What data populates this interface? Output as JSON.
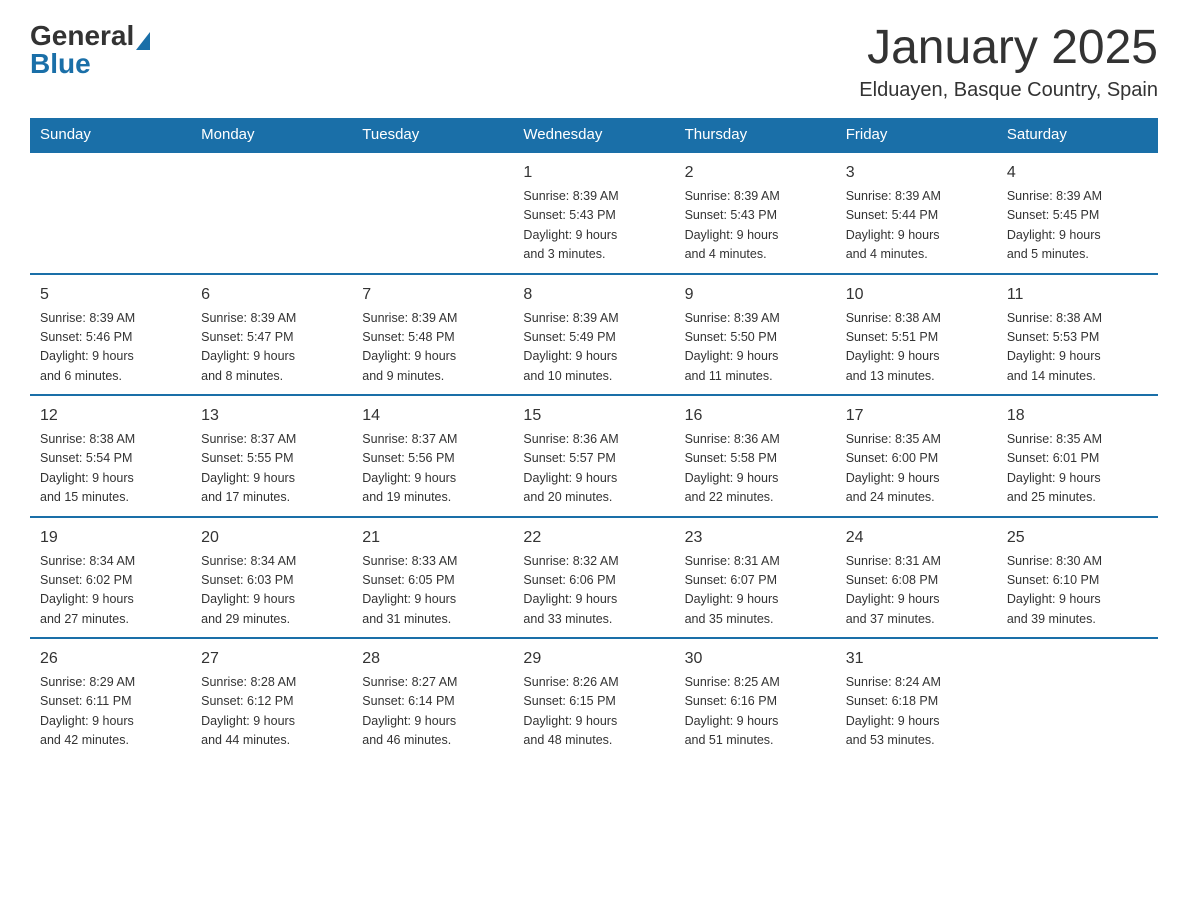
{
  "header": {
    "logo_general": "General",
    "logo_blue": "Blue",
    "month_title": "January 2025",
    "location": "Elduayen, Basque Country, Spain"
  },
  "days_of_week": [
    "Sunday",
    "Monday",
    "Tuesday",
    "Wednesday",
    "Thursday",
    "Friday",
    "Saturday"
  ],
  "weeks": [
    [
      {
        "day": "",
        "info": ""
      },
      {
        "day": "",
        "info": ""
      },
      {
        "day": "",
        "info": ""
      },
      {
        "day": "1",
        "info": "Sunrise: 8:39 AM\nSunset: 5:43 PM\nDaylight: 9 hours\nand 3 minutes."
      },
      {
        "day": "2",
        "info": "Sunrise: 8:39 AM\nSunset: 5:43 PM\nDaylight: 9 hours\nand 4 minutes."
      },
      {
        "day": "3",
        "info": "Sunrise: 8:39 AM\nSunset: 5:44 PM\nDaylight: 9 hours\nand 4 minutes."
      },
      {
        "day": "4",
        "info": "Sunrise: 8:39 AM\nSunset: 5:45 PM\nDaylight: 9 hours\nand 5 minutes."
      }
    ],
    [
      {
        "day": "5",
        "info": "Sunrise: 8:39 AM\nSunset: 5:46 PM\nDaylight: 9 hours\nand 6 minutes."
      },
      {
        "day": "6",
        "info": "Sunrise: 8:39 AM\nSunset: 5:47 PM\nDaylight: 9 hours\nand 8 minutes."
      },
      {
        "day": "7",
        "info": "Sunrise: 8:39 AM\nSunset: 5:48 PM\nDaylight: 9 hours\nand 9 minutes."
      },
      {
        "day": "8",
        "info": "Sunrise: 8:39 AM\nSunset: 5:49 PM\nDaylight: 9 hours\nand 10 minutes."
      },
      {
        "day": "9",
        "info": "Sunrise: 8:39 AM\nSunset: 5:50 PM\nDaylight: 9 hours\nand 11 minutes."
      },
      {
        "day": "10",
        "info": "Sunrise: 8:38 AM\nSunset: 5:51 PM\nDaylight: 9 hours\nand 13 minutes."
      },
      {
        "day": "11",
        "info": "Sunrise: 8:38 AM\nSunset: 5:53 PM\nDaylight: 9 hours\nand 14 minutes."
      }
    ],
    [
      {
        "day": "12",
        "info": "Sunrise: 8:38 AM\nSunset: 5:54 PM\nDaylight: 9 hours\nand 15 minutes."
      },
      {
        "day": "13",
        "info": "Sunrise: 8:37 AM\nSunset: 5:55 PM\nDaylight: 9 hours\nand 17 minutes."
      },
      {
        "day": "14",
        "info": "Sunrise: 8:37 AM\nSunset: 5:56 PM\nDaylight: 9 hours\nand 19 minutes."
      },
      {
        "day": "15",
        "info": "Sunrise: 8:36 AM\nSunset: 5:57 PM\nDaylight: 9 hours\nand 20 minutes."
      },
      {
        "day": "16",
        "info": "Sunrise: 8:36 AM\nSunset: 5:58 PM\nDaylight: 9 hours\nand 22 minutes."
      },
      {
        "day": "17",
        "info": "Sunrise: 8:35 AM\nSunset: 6:00 PM\nDaylight: 9 hours\nand 24 minutes."
      },
      {
        "day": "18",
        "info": "Sunrise: 8:35 AM\nSunset: 6:01 PM\nDaylight: 9 hours\nand 25 minutes."
      }
    ],
    [
      {
        "day": "19",
        "info": "Sunrise: 8:34 AM\nSunset: 6:02 PM\nDaylight: 9 hours\nand 27 minutes."
      },
      {
        "day": "20",
        "info": "Sunrise: 8:34 AM\nSunset: 6:03 PM\nDaylight: 9 hours\nand 29 minutes."
      },
      {
        "day": "21",
        "info": "Sunrise: 8:33 AM\nSunset: 6:05 PM\nDaylight: 9 hours\nand 31 minutes."
      },
      {
        "day": "22",
        "info": "Sunrise: 8:32 AM\nSunset: 6:06 PM\nDaylight: 9 hours\nand 33 minutes."
      },
      {
        "day": "23",
        "info": "Sunrise: 8:31 AM\nSunset: 6:07 PM\nDaylight: 9 hours\nand 35 minutes."
      },
      {
        "day": "24",
        "info": "Sunrise: 8:31 AM\nSunset: 6:08 PM\nDaylight: 9 hours\nand 37 minutes."
      },
      {
        "day": "25",
        "info": "Sunrise: 8:30 AM\nSunset: 6:10 PM\nDaylight: 9 hours\nand 39 minutes."
      }
    ],
    [
      {
        "day": "26",
        "info": "Sunrise: 8:29 AM\nSunset: 6:11 PM\nDaylight: 9 hours\nand 42 minutes."
      },
      {
        "day": "27",
        "info": "Sunrise: 8:28 AM\nSunset: 6:12 PM\nDaylight: 9 hours\nand 44 minutes."
      },
      {
        "day": "28",
        "info": "Sunrise: 8:27 AM\nSunset: 6:14 PM\nDaylight: 9 hours\nand 46 minutes."
      },
      {
        "day": "29",
        "info": "Sunrise: 8:26 AM\nSunset: 6:15 PM\nDaylight: 9 hours\nand 48 minutes."
      },
      {
        "day": "30",
        "info": "Sunrise: 8:25 AM\nSunset: 6:16 PM\nDaylight: 9 hours\nand 51 minutes."
      },
      {
        "day": "31",
        "info": "Sunrise: 8:24 AM\nSunset: 6:18 PM\nDaylight: 9 hours\nand 53 minutes."
      },
      {
        "day": "",
        "info": ""
      }
    ]
  ]
}
